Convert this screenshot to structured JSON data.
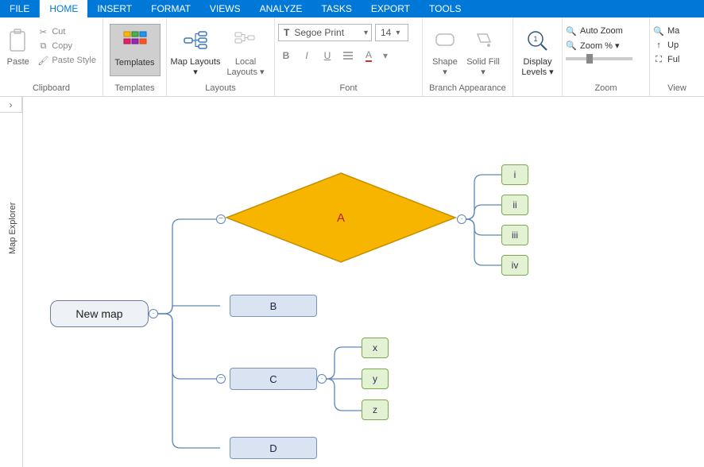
{
  "menu": {
    "file": "FILE",
    "tabs": [
      "HOME",
      "INSERT",
      "FORMAT",
      "VIEWS",
      "ANALYZE",
      "TASKS",
      "EXPORT",
      "TOOLS"
    ],
    "active": 0
  },
  "ribbon": {
    "clipboard": {
      "label": "Clipboard",
      "paste": "Paste",
      "cut": "Cut",
      "copy": "Copy",
      "paste_style": "Paste Style"
    },
    "templates": {
      "label": "Templates",
      "templates": "Templates"
    },
    "layouts": {
      "label": "Layouts",
      "map_layouts": "Map Layouts",
      "local_layouts": "Local Layouts"
    },
    "font": {
      "label": "Font",
      "name": "Segoe Print",
      "size": "14"
    },
    "branch": {
      "label": "Branch Appearance",
      "shape": "Shape",
      "solid_fill": "Solid Fill"
    },
    "display": {
      "levels": "Display Levels"
    },
    "zoom": {
      "label": "Zoom",
      "auto": "Auto Zoom",
      "pct": "Zoom %"
    },
    "view": {
      "label": "View",
      "ma": "Ma",
      "up": "Up",
      "ful": "Ful"
    }
  },
  "side": {
    "label": "Map Explorer"
  },
  "map": {
    "root": "New map",
    "a": "A",
    "b": "B",
    "c": "C",
    "d": "D",
    "a_children": [
      "i",
      "ii",
      "iii",
      "iv"
    ],
    "c_children": [
      "x",
      "y",
      "z"
    ]
  }
}
